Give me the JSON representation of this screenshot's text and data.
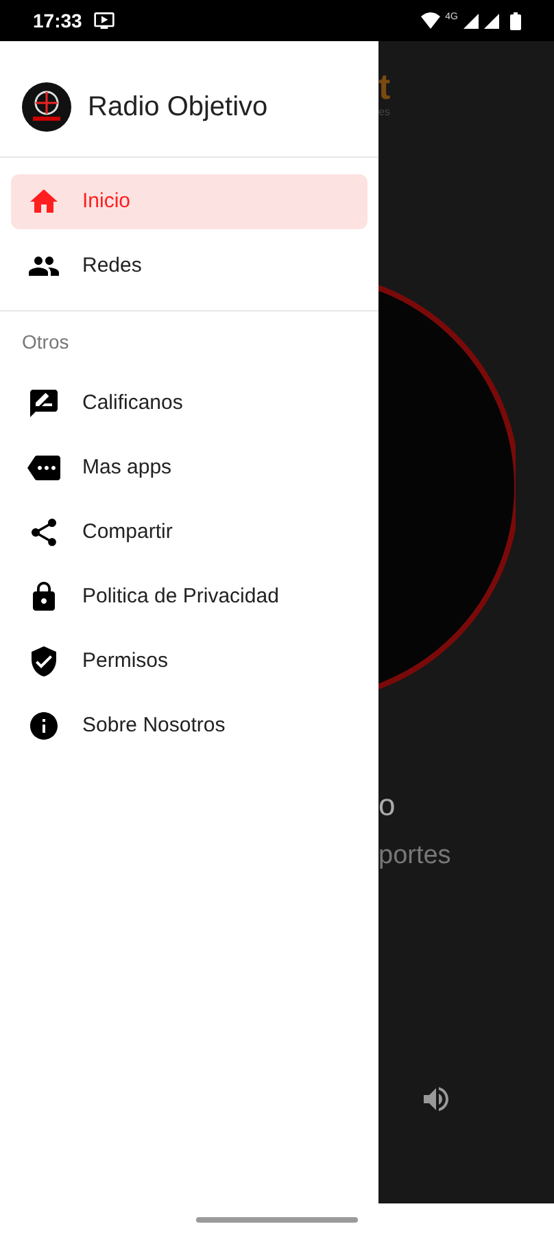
{
  "status_bar": {
    "time": "17:33",
    "network": "4G"
  },
  "drawer": {
    "title": "Radio Objetivo",
    "main_items": [
      {
        "label": "Inicio",
        "selected": true
      },
      {
        "label": "Redes",
        "selected": false
      }
    ],
    "section_label": "Otros",
    "other_items": [
      {
        "label": "Calificanos"
      },
      {
        "label": "Mas apps"
      },
      {
        "label": "Compartir"
      },
      {
        "label": "Politica de Privacidad"
      },
      {
        "label": "Permisos"
      },
      {
        "label": "Sobre Nosotros"
      }
    ]
  },
  "background": {
    "title_fragment": "t",
    "subtitle_fragment": "es",
    "station_fragment": "o",
    "tagline_fragment": "portes"
  }
}
